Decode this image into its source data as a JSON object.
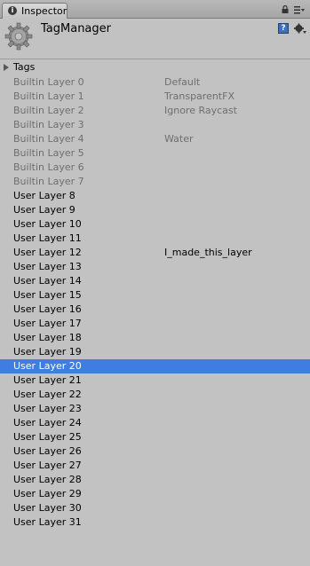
{
  "tab": {
    "label": "Inspector"
  },
  "header": {
    "title": "TagManager"
  },
  "tags": {
    "label": "Tags"
  },
  "layers": [
    {
      "name": "Builtin Layer 0",
      "value": "Default",
      "builtin": true
    },
    {
      "name": "Builtin Layer 1",
      "value": "TransparentFX",
      "builtin": true
    },
    {
      "name": "Builtin Layer 2",
      "value": "Ignore Raycast",
      "builtin": true
    },
    {
      "name": "Builtin Layer 3",
      "value": "",
      "builtin": true
    },
    {
      "name": "Builtin Layer 4",
      "value": "Water",
      "builtin": true
    },
    {
      "name": "Builtin Layer 5",
      "value": "",
      "builtin": true
    },
    {
      "name": "Builtin Layer 6",
      "value": "",
      "builtin": true
    },
    {
      "name": "Builtin Layer 7",
      "value": "",
      "builtin": true
    },
    {
      "name": "User Layer 8",
      "value": ""
    },
    {
      "name": "User Layer 9",
      "value": ""
    },
    {
      "name": "User Layer 10",
      "value": ""
    },
    {
      "name": "User Layer 11",
      "value": ""
    },
    {
      "name": "User Layer 12",
      "value": "I_made_this_layer"
    },
    {
      "name": "User Layer 13",
      "value": ""
    },
    {
      "name": "User Layer 14",
      "value": ""
    },
    {
      "name": "User Layer 15",
      "value": ""
    },
    {
      "name": "User Layer 16",
      "value": ""
    },
    {
      "name": "User Layer 17",
      "value": ""
    },
    {
      "name": "User Layer 18",
      "value": ""
    },
    {
      "name": "User Layer 19",
      "value": ""
    },
    {
      "name": "User Layer 20",
      "value": "",
      "selected": true
    },
    {
      "name": "User Layer 21",
      "value": ""
    },
    {
      "name": "User Layer 22",
      "value": ""
    },
    {
      "name": "User Layer 23",
      "value": ""
    },
    {
      "name": "User Layer 24",
      "value": ""
    },
    {
      "name": "User Layer 25",
      "value": ""
    },
    {
      "name": "User Layer 26",
      "value": ""
    },
    {
      "name": "User Layer 27",
      "value": ""
    },
    {
      "name": "User Layer 28",
      "value": ""
    },
    {
      "name": "User Layer 29",
      "value": ""
    },
    {
      "name": "User Layer 30",
      "value": ""
    },
    {
      "name": "User Layer 31",
      "value": ""
    }
  ],
  "colors": {
    "selection": "#3e7ee0",
    "panel": "#c2c2c2",
    "builtin_text": "#6e6e6e"
  },
  "icons": [
    "info-icon",
    "lock-icon",
    "menu-icon",
    "gear-icon",
    "help-icon",
    "settings-icon",
    "expand-triangle-icon"
  ]
}
